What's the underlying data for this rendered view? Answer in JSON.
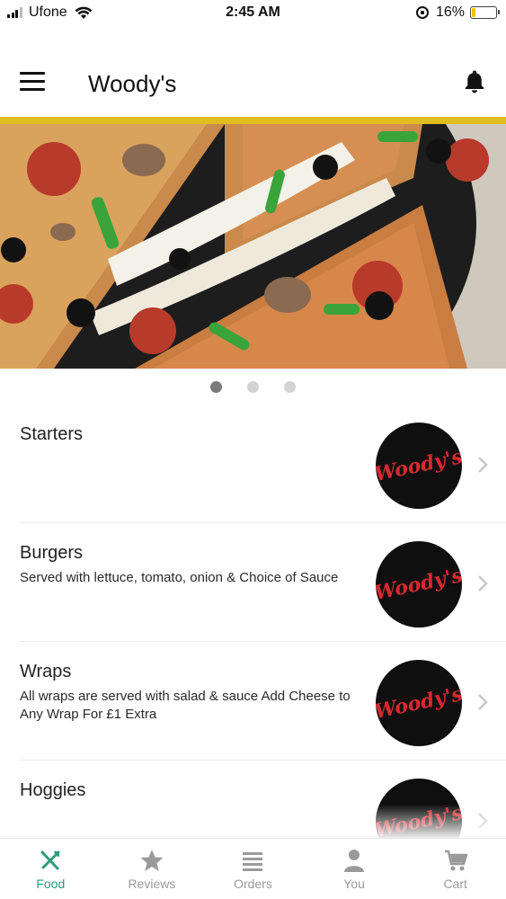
{
  "status_bar": {
    "carrier": "Ufone",
    "time": "2:45 AM",
    "battery": "16%",
    "battery_level": 0.16,
    "icons": [
      "signal-icon",
      "wifi-icon",
      "rotation-lock-icon",
      "battery-icon"
    ]
  },
  "header": {
    "title": "Woody's",
    "icons": [
      "menu-icon",
      "bell-icon"
    ],
    "accent_color": "#e2bd1f"
  },
  "carousel": {
    "slide_count": 3,
    "active_index": 0
  },
  "categories": [
    {
      "title": "Starters",
      "description": "",
      "logo_text": "Woody's"
    },
    {
      "title": "Burgers",
      "description": "Served with lettuce, tomato, onion & Choice of Sauce",
      "logo_text": "Woody's"
    },
    {
      "title": "Wraps",
      "description": "All wraps are served with salad & sauce Add Cheese to Any Wrap For £1 Extra",
      "logo_text": "Woody's"
    },
    {
      "title": "Hoggies",
      "description": "",
      "logo_text": "Woody's"
    }
  ],
  "tabs": [
    {
      "label": "Food",
      "icon": "fork-knife-icon",
      "active": true
    },
    {
      "label": "Reviews",
      "icon": "star-icon",
      "active": false
    },
    {
      "label": "Orders",
      "icon": "list-icon",
      "active": false
    },
    {
      "label": "You",
      "icon": "person-icon",
      "active": false
    },
    {
      "label": "Cart",
      "icon": "cart-icon",
      "active": false
    }
  ],
  "colors": {
    "active_tab": "#2e9c7c",
    "inactive_tab": "#9a9a9a",
    "logo_red": "#d6292f"
  }
}
